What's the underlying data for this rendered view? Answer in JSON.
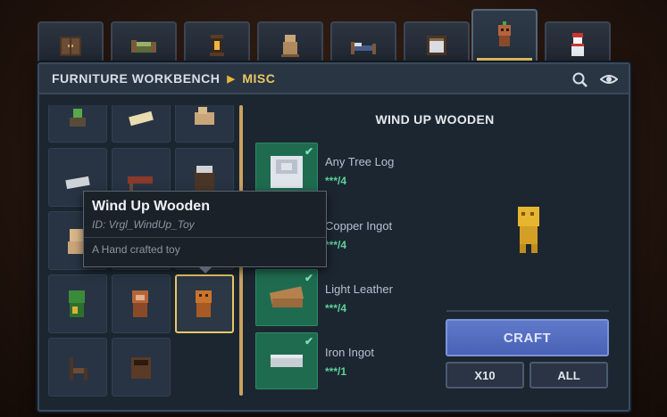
{
  "header": {
    "title": "FURNITURE WORKBENCH",
    "separator_icon": "triangle-right",
    "category": "MISC"
  },
  "tabs": [
    {
      "icon": "wardrobe-icon"
    },
    {
      "icon": "bed-icon"
    },
    {
      "icon": "lantern-icon"
    },
    {
      "icon": "pot-icon"
    },
    {
      "icon": "cot-icon"
    },
    {
      "icon": "crate-icon"
    },
    {
      "icon": "wind-up-toy-icon",
      "active": true
    },
    {
      "icon": "snowman-icon"
    }
  ],
  "recipe": {
    "title": "WIND UP WOODEN",
    "ingredients": [
      {
        "name": "Any Tree Log",
        "count": "***/4",
        "checked": true
      },
      {
        "name": "Copper Ingot",
        "count": "***/4",
        "checked": false
      },
      {
        "name": "Light Leather",
        "count": "***/4",
        "checked": true
      },
      {
        "name": "Iron Ingot",
        "count": "***/1",
        "checked": true
      }
    ]
  },
  "buttons": {
    "craft": "CRAFT",
    "x10": "X10",
    "all": "ALL"
  },
  "tooltip": {
    "name": "Wind Up Wooden",
    "id": "ID: Vrgl_WindUp_Toy",
    "description": "A Hand crafted toy"
  },
  "colors": {
    "accent_gold": "#e8c766",
    "ingredient_green": "#1f6b50",
    "count_green": "#5ed19a",
    "craft_blue": "#5068b8"
  }
}
